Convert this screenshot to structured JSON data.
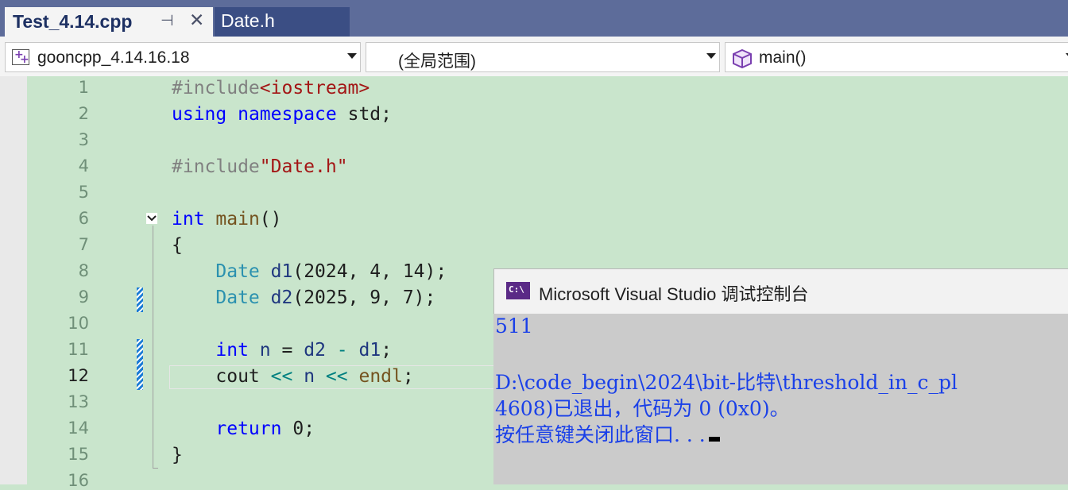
{
  "tabs": [
    {
      "label": "Test_4.14.cpp",
      "active": true
    },
    {
      "label": "Date.h",
      "active": false
    }
  ],
  "navbar": {
    "project": "gooncpp_4.14.16.18",
    "scope": "(全局范围)",
    "member": "main()"
  },
  "editor": {
    "current_line": 12,
    "lines": [
      {
        "n": "1",
        "text": "#include<iostream>"
      },
      {
        "n": "2",
        "text": "using namespace std;"
      },
      {
        "n": "3",
        "text": ""
      },
      {
        "n": "4",
        "text": "#include\"Date.h\""
      },
      {
        "n": "5",
        "text": ""
      },
      {
        "n": "6",
        "text": "int main()"
      },
      {
        "n": "7",
        "text": "{"
      },
      {
        "n": "8",
        "text": "    Date d1(2024, 4, 14);"
      },
      {
        "n": "9",
        "text": "    Date d2(2025, 9, 7);"
      },
      {
        "n": "10",
        "text": ""
      },
      {
        "n": "11",
        "text": "    int n = d2 - d1;"
      },
      {
        "n": "12",
        "text": "    cout << n << endl;"
      },
      {
        "n": "13",
        "text": ""
      },
      {
        "n": "14",
        "text": "    return 0;"
      },
      {
        "n": "15",
        "text": "}"
      },
      {
        "n": "16",
        "text": ""
      }
    ],
    "tokens": {
      "l1_directive": "#include",
      "l1_header": "<iostream>",
      "l2_using": "using",
      "l2_namespace": "namespace",
      "l2_std": "std;",
      "l4_directive": "#include",
      "l4_header": "\"Date.h\"",
      "l6_int": "int",
      "l6_main": "main",
      "l6_parens": "()",
      "l7_brace": "{",
      "l8_type": "Date",
      "l8_var": "d1",
      "l8_args": "(2024, 4, 14);",
      "l9_type": "Date",
      "l9_var": "d2",
      "l9_args": "(2025, 9, 7);",
      "l11_int": "int",
      "l11_n": "n",
      "l11_eq": "=",
      "l11_d2": "d2",
      "l11_minus": "-",
      "l11_d1": "d1",
      "l11_semi": ";",
      "l12_cout": "cout",
      "l12_op1": "<<",
      "l12_n": "n",
      "l12_op2": "<<",
      "l12_endl": "endl",
      "l12_semi": ";",
      "l14_return": "return",
      "l14_zero": "0;",
      "l15_brace": "}"
    }
  },
  "console": {
    "title": "Microsoft Visual Studio 调试控制台",
    "icon_label": "C:\\",
    "lines": [
      "511",
      "",
      "D:\\code_begin\\2024\\bit-比特\\threshold_in_c_pl",
      "4608)已退出，代码为 0 (0x0)。",
      "按任意键关闭此窗口. . ."
    ]
  },
  "colors": {
    "tabbar": "#5d6c9a",
    "editor_bg": "#c9e5cc",
    "keyword": "#0000ff",
    "type": "#2b91af",
    "string": "#a31515",
    "console_text": "#1a40e8"
  }
}
